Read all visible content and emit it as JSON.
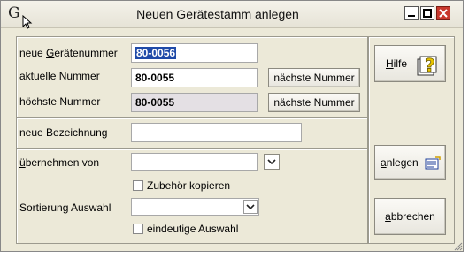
{
  "window": {
    "title": "Neuen Gerätestamm anlegen",
    "app_glyph": "G",
    "controls": [
      "minimize-icon",
      "maximize-icon",
      "close-icon"
    ]
  },
  "form": {
    "new_device_number_label_pre": "neue ",
    "new_device_number_label_u": "G",
    "new_device_number_label_post": "erätenummer",
    "new_device_number_value": "80-0056",
    "current_number_label": "aktuelle Nummer",
    "current_number_value": "80-0055",
    "highest_number_label": "höchste Nummer",
    "highest_number_value": "80-0055",
    "next_number_button": "nächste Nummer",
    "new_description_label": "neue Bezeichnung",
    "new_description_value": "",
    "take_over_from_label_u": "ü",
    "take_over_from_label_post": "bernehmen von",
    "take_over_from_value": "",
    "copy_accessories_label": "Zubehör kopieren",
    "copy_accessories_checked": false,
    "sort_selection_label": "Sortierung Auswahl",
    "sort_selection_value": "",
    "unique_selection_label": "eindeutige Auswahl",
    "unique_selection_checked": false
  },
  "actions": {
    "help_u": "H",
    "help_post": "ilfe",
    "create_u": "a",
    "create_post": "nlegen",
    "cancel_u": "a",
    "cancel_post": "bbrechen"
  },
  "colors": {
    "window_bg": "#ece9d8",
    "close_button": "#c8382c",
    "selection": "#1f4aa8",
    "readonly_field": "#e4e0e4"
  }
}
